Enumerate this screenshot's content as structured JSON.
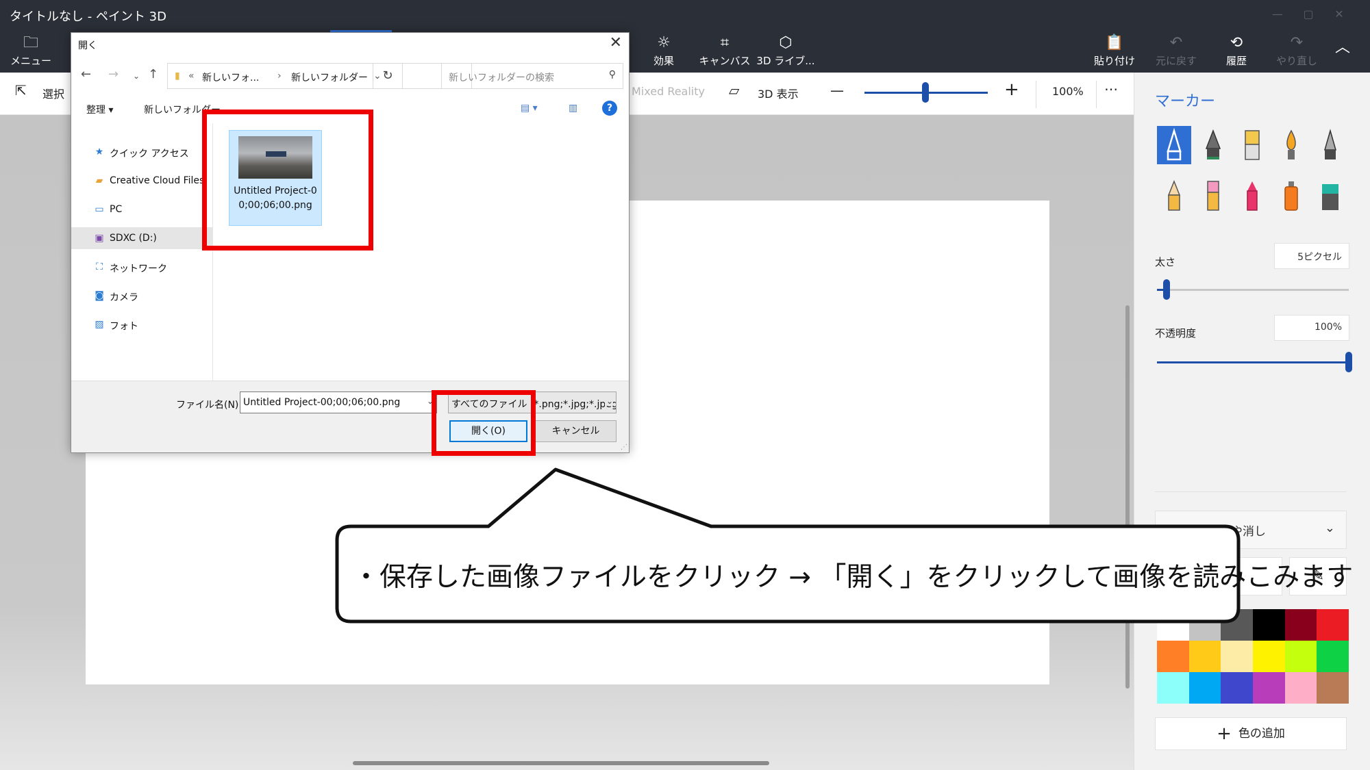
{
  "window": {
    "title": "タイトルなし - ペイント 3D"
  },
  "ribbon": {
    "menu_label": "メニュー",
    "effects_label": "効果",
    "canvas_label": "キャンバス",
    "library_label": "3D ライブ...",
    "paste_label": "貼り付け",
    "undo_label": "元に戻す",
    "history_label": "履歴",
    "redo_label": "やり直し"
  },
  "toolbar": {
    "select_label": "選択",
    "mixed_reality_label": "Mixed Reality",
    "view3d_label": "3D 表示",
    "zoom_value": "100%",
    "zoom_fraction": 0.5
  },
  "panel": {
    "title": "マーカー",
    "thickness_label": "太さ",
    "thickness_value": "5ピクセル",
    "thickness_fraction": 0.05,
    "opacity_label": "不透明度",
    "opacity_value": "100%",
    "opacity_fraction": 1.0,
    "undo_dropdown_label": "や消し",
    "add_color_label": "色の追加",
    "palette_colors": [
      "#ffffff",
      "#c3c3c3",
      "#585858",
      "#000000",
      "#88001b",
      "#ec1c24",
      "#ff7f27",
      "#ffca18",
      "#fdeca6",
      "#fff200",
      "#c4ff0e",
      "#0ed145",
      "#8cfffb",
      "#00a8f3",
      "#3f48cc",
      "#b83dba",
      "#ffaec8",
      "#b97a56"
    ],
    "accent_color": "#2f6fd3"
  },
  "dialog": {
    "title": "開く",
    "address": {
      "segment1": "新しいフォ...",
      "segment2": "新しいフォルダー"
    },
    "search_placeholder": "新しいフォルダーの検索",
    "organize_label": "整理 ▾",
    "new_folder_label": "新しいフォルダー",
    "nav_items": [
      {
        "label": "クイック アクセス",
        "icon": "star-icon"
      },
      {
        "label": "Creative Cloud Files",
        "icon": "cloud-folder-icon"
      },
      {
        "label": "PC",
        "icon": "pc-icon"
      },
      {
        "label": "SDXC (D:)",
        "icon": "sd-card-icon"
      },
      {
        "label": "ネットワーク",
        "icon": "network-icon"
      },
      {
        "label": "カメラ",
        "icon": "camera-folder-icon"
      },
      {
        "label": "フォト",
        "icon": "photos-folder-icon"
      }
    ],
    "file": {
      "name": "Untitled Project-00;00;06;00.png"
    },
    "filename_label": "ファイル名(N):",
    "filename_value": "Untitled Project-00;00;06;00.png",
    "filetype_value": "すべてのファイル (*.png;*.jpg;*.jpeg",
    "open_button": "開く(O)",
    "cancel_button": "キャンセル"
  },
  "callout": {
    "text": "・保存した画像ファイルをクリック → 「開く」をクリックして画像を読みこみます"
  }
}
